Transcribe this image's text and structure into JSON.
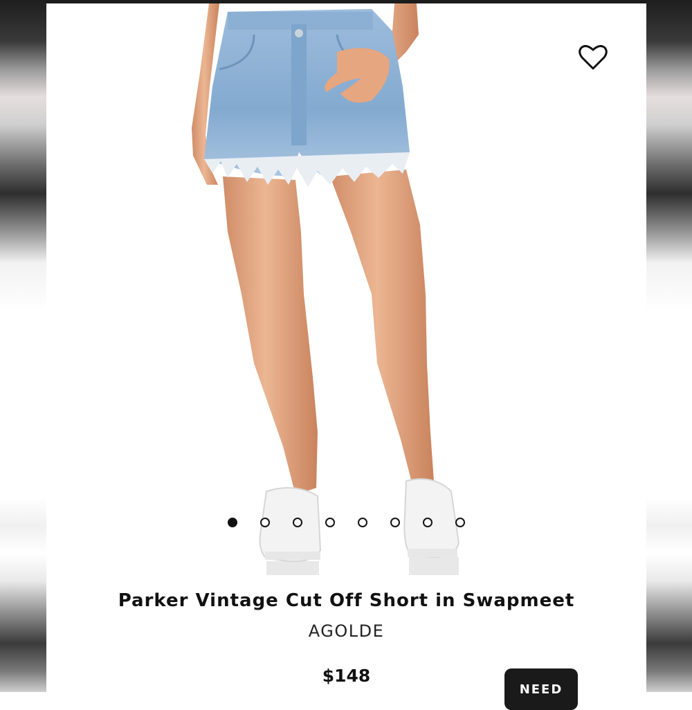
{
  "product": {
    "title": "Parker Vintage Cut Off Short in Swapmeet",
    "brand": "AGOLDE",
    "price": "$148"
  },
  "gallery": {
    "image_count": 8,
    "active_index": 0
  },
  "actions": {
    "help_label": "NEED"
  },
  "icons": {
    "wishlist": "heart-icon"
  },
  "colors": {
    "accent": "#111111",
    "button_bg": "#1a1a1a",
    "denim": "#8fb3d6",
    "skin": "#e1a47e"
  }
}
